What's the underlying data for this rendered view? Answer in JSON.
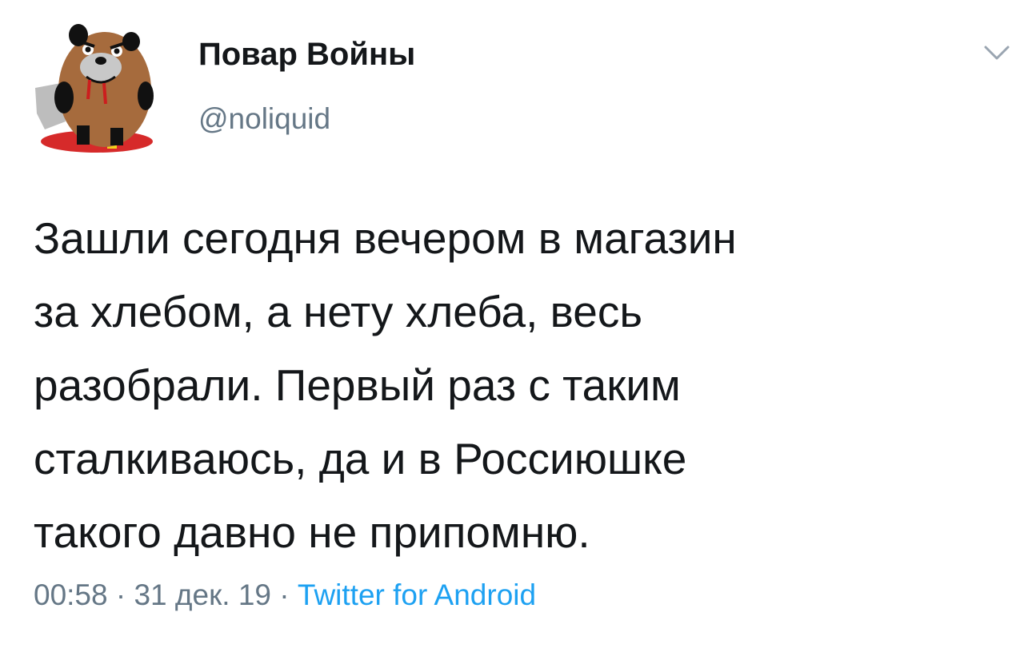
{
  "author": {
    "display_name": "Повар Войны",
    "handle": "@noliquid",
    "avatar_icon": "bear-avatar-icon"
  },
  "menu": {
    "icon": "chevron-down-icon"
  },
  "tweet": {
    "lines": [
      "Зашли сегодня вечером в магазин",
      "за хлебом, а нету хлеба, весь",
      "разобрали. Первый раз с таким",
      "сталкиваюсь, да и в Россиюшке",
      "такого давно не припомню."
    ]
  },
  "meta": {
    "time": "00:58",
    "separator": " · ",
    "date": "31 дек. 19",
    "source": "Twitter for Android"
  },
  "colors": {
    "text": "#14171a",
    "secondary": "#657786",
    "link": "#1da1f2"
  }
}
